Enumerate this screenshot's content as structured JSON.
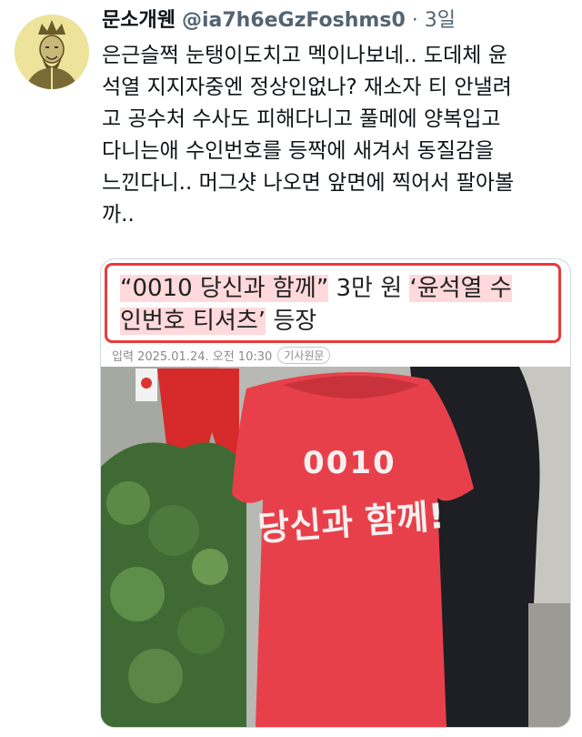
{
  "tweet": {
    "display_name": "문소개웬",
    "handle": "@ia7h6eGzFoshms0",
    "separator": "·",
    "time": "3일",
    "body_lines": [
      "은근슬쩍 눈탱이도치고 멕이나보네.. 도데체 윤",
      "석열 지지자중엔 정상인없나?  재소자 티 안낼려",
      "고 공수처 수사도 피해다니고 풀메에 양복입고",
      "다니는애 수인번호를 등짝에 새겨서 동질감을",
      "느낀다니.. 머그샷 나오면 앞면에 찍어서 팔아볼",
      "까.."
    ]
  },
  "card": {
    "headline_line1_a": "“0010 당신과 함께”",
    "headline_line1_b": " 3만 원 ",
    "headline_line1_c": "‘윤석열 수",
    "headline_line2_a": "인번호 티셔츠’",
    "headline_line2_b": " 등장",
    "date_label": "입력 2025.01.24. 오전 10:30",
    "origin_badge": "기사원문",
    "shirt_number": "0010",
    "shirt_slogan": "당신과 함께!"
  },
  "colors": {
    "headline_border": "#e83b3b",
    "highlight": "#ffd9db",
    "shirt_red": "#e8404a"
  }
}
